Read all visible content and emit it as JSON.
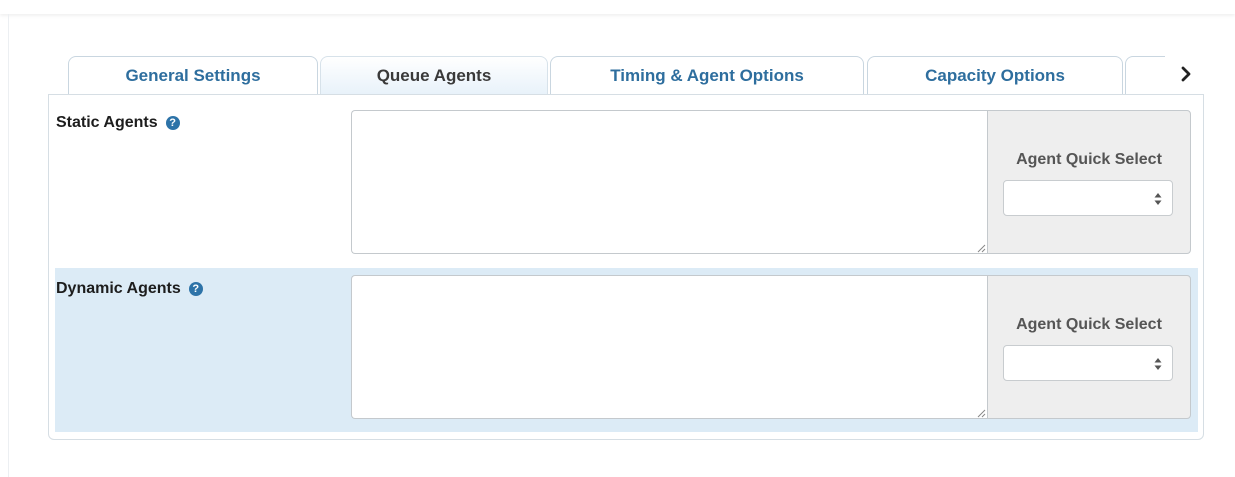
{
  "tabs": [
    {
      "label": "General Settings",
      "active": false
    },
    {
      "label": "Queue Agents",
      "active": true
    },
    {
      "label": "Timing & Agent Options",
      "active": false
    },
    {
      "label": "Capacity Options",
      "active": false
    },
    {
      "label": "",
      "active": false
    }
  ],
  "tab_scroll_icon": "chevron-right-icon",
  "static_agents": {
    "label": "Static Agents",
    "help_icon": "question-circle-icon",
    "help_glyph": "?",
    "textarea_value": "",
    "quick_select_label": "Agent Quick Select",
    "quick_select_value": ""
  },
  "dynamic_agents": {
    "label": "Dynamic Agents",
    "help_icon": "question-circle-icon",
    "help_glyph": "?",
    "textarea_value": "",
    "quick_select_label": "Agent Quick Select",
    "quick_select_value": ""
  },
  "colors": {
    "tab_text": "#2e6e9e",
    "active_tab_text": "#3a3a3a",
    "highlight_row": "#dcebf6",
    "help_icon": "#2d73a8",
    "addon_background": "#eeeeee"
  }
}
